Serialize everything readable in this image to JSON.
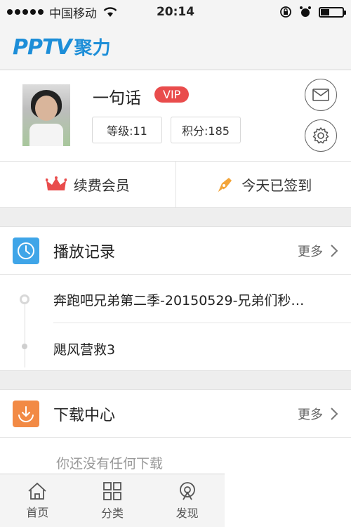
{
  "status_bar": {
    "carrier": "中国移动",
    "time": "20:14"
  },
  "header": {
    "logo_latin": "PPTV",
    "logo_cn": "聚力"
  },
  "profile": {
    "username": "一句话",
    "vip_label": "VIP",
    "level": "等级:11",
    "points": "积分:185"
  },
  "actions": {
    "renew": "续费会员",
    "checkin": "今天已签到"
  },
  "history": {
    "title": "播放记录",
    "more": "更多",
    "items": [
      "奔跑吧兄弟第二季-20150529-兄弟们秒…",
      "飓风营救3"
    ]
  },
  "download": {
    "title": "下载中心",
    "more": "更多",
    "empty": "你还没有任何下载"
  },
  "tabs": [
    {
      "label": "首页",
      "icon": "home-icon"
    },
    {
      "label": "分类",
      "icon": "grid-icon"
    },
    {
      "label": "发现",
      "icon": "discover-icon"
    }
  ],
  "colors": {
    "brand": "#1d8ed8",
    "vip": "#e94c4c",
    "history_icon": "#3fa5e8",
    "download_icon": "#f28a45"
  }
}
